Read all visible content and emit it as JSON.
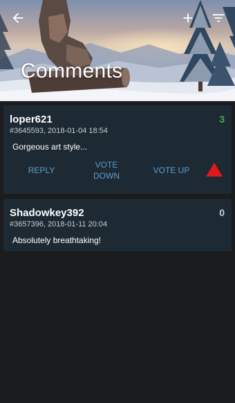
{
  "header": {
    "title": "Comments",
    "back_icon": "arrow-left-icon",
    "add_icon": "plus-icon",
    "filter_icon": "filter-icon"
  },
  "comments": [
    {
      "username": "loper621",
      "meta": "#3645593, 2018-01-04 18:54",
      "score": "3",
      "text": "Gorgeous art style...",
      "actions": {
        "reply": "REPLY",
        "vote_down_line1": "VOTE",
        "vote_down_line2": "DOWN",
        "vote_up": "VOTE UP"
      }
    },
    {
      "username": "Shadowkey392",
      "meta": "#3657396, 2018-01-11 20:04",
      "score": "0",
      "text": "Absolutely breathtaking!"
    }
  ],
  "colors": {
    "background": "#1b1c1e",
    "card": "#1d2a33",
    "action_text": "#5b9fd6",
    "score_positive": "#3bb54a",
    "vote_up_arrow": "#e0191c"
  }
}
